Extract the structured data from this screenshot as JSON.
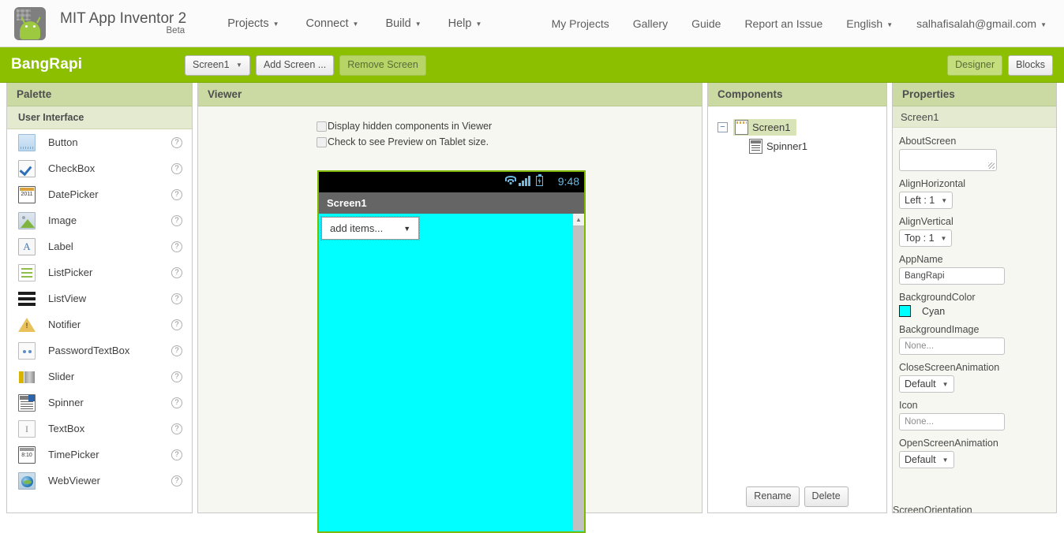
{
  "topbar": {
    "logo_icon": "android-robot-icon",
    "brand_name": "MIT App Inventor 2",
    "brand_sub": "Beta",
    "menus": [
      {
        "label": "Projects",
        "has_caret": true
      },
      {
        "label": "Connect",
        "has_caret": true
      },
      {
        "label": "Build",
        "has_caret": true
      },
      {
        "label": "Help",
        "has_caret": true
      }
    ],
    "right_menus": [
      {
        "label": "My Projects",
        "has_caret": false
      },
      {
        "label": "Gallery",
        "has_caret": false
      },
      {
        "label": "Guide",
        "has_caret": false
      },
      {
        "label": "Report an Issue",
        "has_caret": false
      },
      {
        "label": "English",
        "has_caret": true
      },
      {
        "label": "salhafisalah@gmail.com",
        "has_caret": true
      }
    ]
  },
  "projectbar": {
    "project_name": "BangRapi",
    "screen_select": "Screen1",
    "add_screen": "Add Screen ...",
    "remove_screen": "Remove Screen",
    "designer_btn": "Designer",
    "blocks_btn": "Blocks",
    "bar_color": "#8cbf00"
  },
  "palette": {
    "title": "Palette",
    "category": "User Interface",
    "help_glyph": "?",
    "items": [
      {
        "label": "Button",
        "icon": "button-icon"
      },
      {
        "label": "CheckBox",
        "icon": "checkbox-icon"
      },
      {
        "label": "DatePicker",
        "icon": "datepicker-icon"
      },
      {
        "label": "Image",
        "icon": "image-icon"
      },
      {
        "label": "Label",
        "icon": "label-icon"
      },
      {
        "label": "ListPicker",
        "icon": "listpicker-icon"
      },
      {
        "label": "ListView",
        "icon": "listview-icon"
      },
      {
        "label": "Notifier",
        "icon": "notifier-icon"
      },
      {
        "label": "PasswordTextBox",
        "icon": "passwordtextbox-icon"
      },
      {
        "label": "Slider",
        "icon": "slider-icon"
      },
      {
        "label": "Spinner",
        "icon": "spinner-icon"
      },
      {
        "label": "TextBox",
        "icon": "textbox-icon"
      },
      {
        "label": "TimePicker",
        "icon": "timepicker-icon"
      },
      {
        "label": "WebViewer",
        "icon": "webviewer-icon"
      }
    ]
  },
  "viewer": {
    "title": "Viewer",
    "display_hidden_label": "Display hidden components in Viewer",
    "display_hidden_checked": false,
    "tablet_preview_label": "Check to see Preview on Tablet size.",
    "tablet_preview_checked": false,
    "phone": {
      "status_time": "9:48",
      "status_icons": [
        "wifi-icon",
        "signal-bars-icon",
        "battery-charging-icon"
      ],
      "title": "Screen1",
      "background_color": "#00ffff",
      "spinner_text": "add items...",
      "spinner_caret": "▼",
      "scroll_up_glyph": "▲"
    }
  },
  "components": {
    "title": "Components",
    "expander_glyph": "−",
    "tree": [
      {
        "label": "Screen1",
        "icon": "screen-icon",
        "selected": true,
        "depth": 0
      },
      {
        "label": "Spinner1",
        "icon": "spinner-icon",
        "selected": false,
        "depth": 1
      }
    ],
    "rename_btn": "Rename",
    "delete_btn": "Delete"
  },
  "properties": {
    "title": "Properties",
    "selected_component": "Screen1",
    "caret_glyph": "▼",
    "fields": [
      {
        "label": "AboutScreen",
        "type": "textarea",
        "value": ""
      },
      {
        "label": "AlignHorizontal",
        "type": "select",
        "value": "Left : 1"
      },
      {
        "label": "AlignVertical",
        "type": "select",
        "value": "Top : 1"
      },
      {
        "label": "AppName",
        "type": "text",
        "value": "BangRapi"
      },
      {
        "label": "BackgroundColor",
        "type": "color",
        "value": "Cyan",
        "swatch": "#00ffff"
      },
      {
        "label": "BackgroundImage",
        "type": "text",
        "value": "None..."
      },
      {
        "label": "CloseScreenAnimation",
        "type": "select",
        "value": "Default"
      },
      {
        "label": "Icon",
        "type": "text",
        "value": "None..."
      },
      {
        "label": "OpenScreenAnimation",
        "type": "select",
        "value": "Default"
      },
      {
        "label": "ScreenOrientation",
        "type": "cutoff",
        "value": ""
      }
    ]
  }
}
